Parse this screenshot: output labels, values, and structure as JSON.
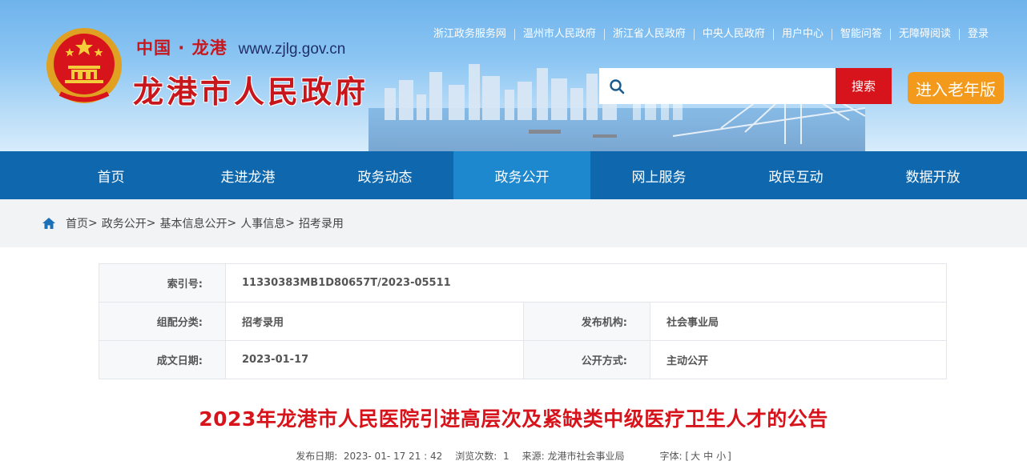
{
  "header": {
    "site_cn": "中国 · 龙港",
    "site_url": "www.zjlg.gov.cn",
    "site_title": "龙港市人民政府",
    "top_links": [
      "浙江政务服务网",
      "温州市人民政府",
      "浙江省人民政府",
      "中央人民政府",
      "用户中心",
      "智能问答",
      "无障碍阅读",
      "登录"
    ],
    "search_placeholder": "",
    "search_button": "搜索",
    "elder_button": "进入老年版"
  },
  "nav": {
    "items": [
      "首页",
      "走进龙港",
      "政务动态",
      "政务公开",
      "网上服务",
      "政民互动",
      "数据开放"
    ],
    "active_index": 3
  },
  "breadcrumb": {
    "items": [
      "首页",
      "政务公开",
      "基本信息公开",
      "人事信息",
      "招考录用"
    ],
    "separator": ">"
  },
  "meta": {
    "index_label": "索引号:",
    "index_value": "11330383MB1D80657T/2023-05511",
    "category_label": "组配分类:",
    "category_value": "招考录用",
    "org_label": "发布机构:",
    "org_value": "社会事业局",
    "date_label": "成文日期:",
    "date_value": "2023-01-17",
    "open_label": "公开方式:",
    "open_value": "主动公开"
  },
  "article": {
    "title": "2023年龙港市人民医院引进高层次及紧缺类中级医疗卫生人才的公告",
    "publish_label": "发布日期:",
    "publish_value": "2023- 01- 17 21 : 42",
    "views_label": "浏览次数:",
    "views_value": "1",
    "source_label": "来源:",
    "source_value": "龙港市社会事业局",
    "font_label": "字体:",
    "font_open": "[",
    "font_large": "大",
    "font_medium": "中",
    "font_small": "小",
    "font_close": "]"
  },
  "colors": {
    "brand_red": "#d7141b",
    "nav_blue": "#0f68ae",
    "nav_active": "#1e88cf",
    "elder_orange": "#f39a1c"
  }
}
